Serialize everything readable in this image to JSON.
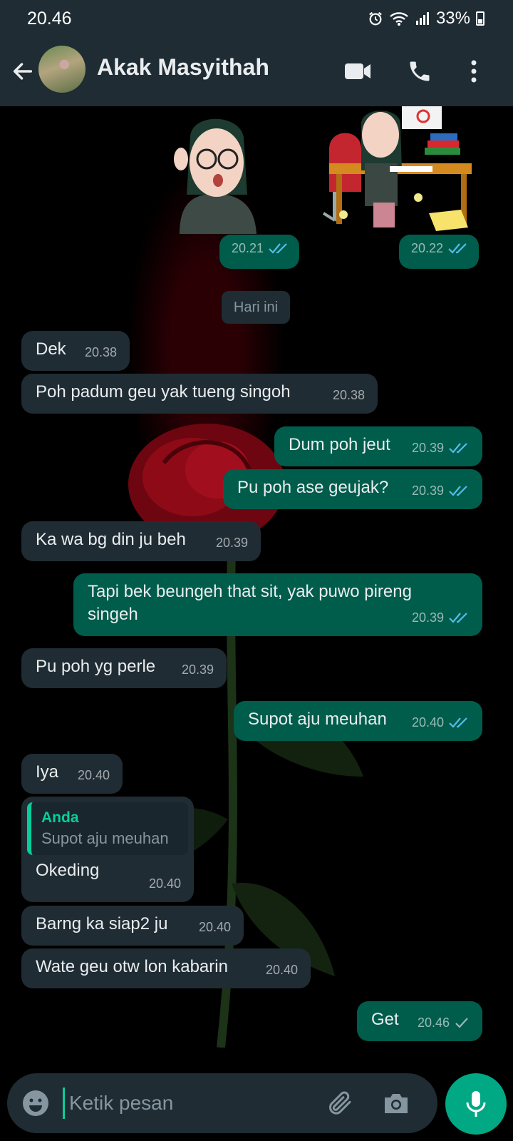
{
  "status_bar": {
    "time": "20.46",
    "battery": "33%"
  },
  "header": {
    "contact_name": "Akak Masyithah",
    "icons": [
      "back-arrow-icon",
      "video-call-icon",
      "voice-call-icon",
      "more-options-icon"
    ]
  },
  "colors": {
    "header_bg": "#1f2c34",
    "incoming_bubble": "#202c33",
    "outgoing_bubble": "#005c4b",
    "accent": "#00a884",
    "read_tick": "#53bdeb"
  },
  "stickers": [
    {
      "time": "20.21",
      "status": "read"
    },
    {
      "time": "20.22",
      "status": "read"
    }
  ],
  "date_divider": "Hari ini",
  "messages": [
    {
      "dir": "in",
      "text": "Dek",
      "time": "20.38"
    },
    {
      "dir": "in",
      "text": "Poh padum geu yak tueng singoh",
      "time": "20.38"
    },
    {
      "dir": "out",
      "text": "Dum poh jeut",
      "time": "20.39",
      "status": "read"
    },
    {
      "dir": "out",
      "text": "Pu poh ase geujak?",
      "time": "20.39",
      "status": "read"
    },
    {
      "dir": "in",
      "text": "Ka wa bg din ju beh",
      "time": "20.39"
    },
    {
      "dir": "out",
      "text": "Tapi bek beungeh that sit, yak puwo pireng singeh",
      "time": "20.39",
      "status": "read"
    },
    {
      "dir": "in",
      "text": "Pu poh yg perle",
      "time": "20.39"
    },
    {
      "dir": "out",
      "text": "Supot aju meuhan",
      "time": "20.40",
      "status": "read"
    },
    {
      "dir": "in",
      "text": "Iya",
      "time": "20.40"
    },
    {
      "dir": "in",
      "text": "Okeding",
      "time": "20.40",
      "quote": {
        "author": "Anda",
        "text": "Supot aju meuhan"
      }
    },
    {
      "dir": "in",
      "text": "Barng ka siap2 ju",
      "time": "20.40"
    },
    {
      "dir": "in",
      "text": "Wate geu otw lon kabarin",
      "time": "20.40"
    },
    {
      "dir": "out",
      "text": "Get",
      "time": "20.46",
      "status": "sent"
    }
  ],
  "composer": {
    "placeholder": "Ketik pesan"
  }
}
